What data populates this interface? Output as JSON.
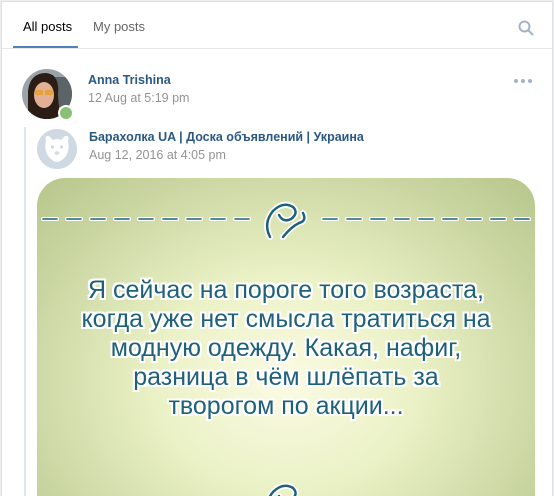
{
  "tabs": [
    {
      "label": "All posts",
      "active": true
    },
    {
      "label": "My posts",
      "active": false
    }
  ],
  "post": {
    "author": "Anna Trishina",
    "date": "12 Aug at 5:19 pm",
    "online": true,
    "repost": {
      "source": "Барахолка UA | Доска объявлений | Украина",
      "date": "Aug 12, 2016 at 4:05 pm",
      "image_text": [
        "Я сейчас на пороге того возраста,",
        "когда уже нет смысла тратиться на",
        "модную одежду. Какая, нафиг,",
        "разница в чём шлёпать за",
        "творогом по акции..."
      ]
    }
  },
  "colors": {
    "link": "#2a5885",
    "accent": "#5181b8",
    "muted": "#939393",
    "online": "#8ac176",
    "quote_text": "#1f617a"
  },
  "icons": [
    "search-icon",
    "more-icon",
    "ornament-icon",
    "dog-avatar-icon"
  ]
}
